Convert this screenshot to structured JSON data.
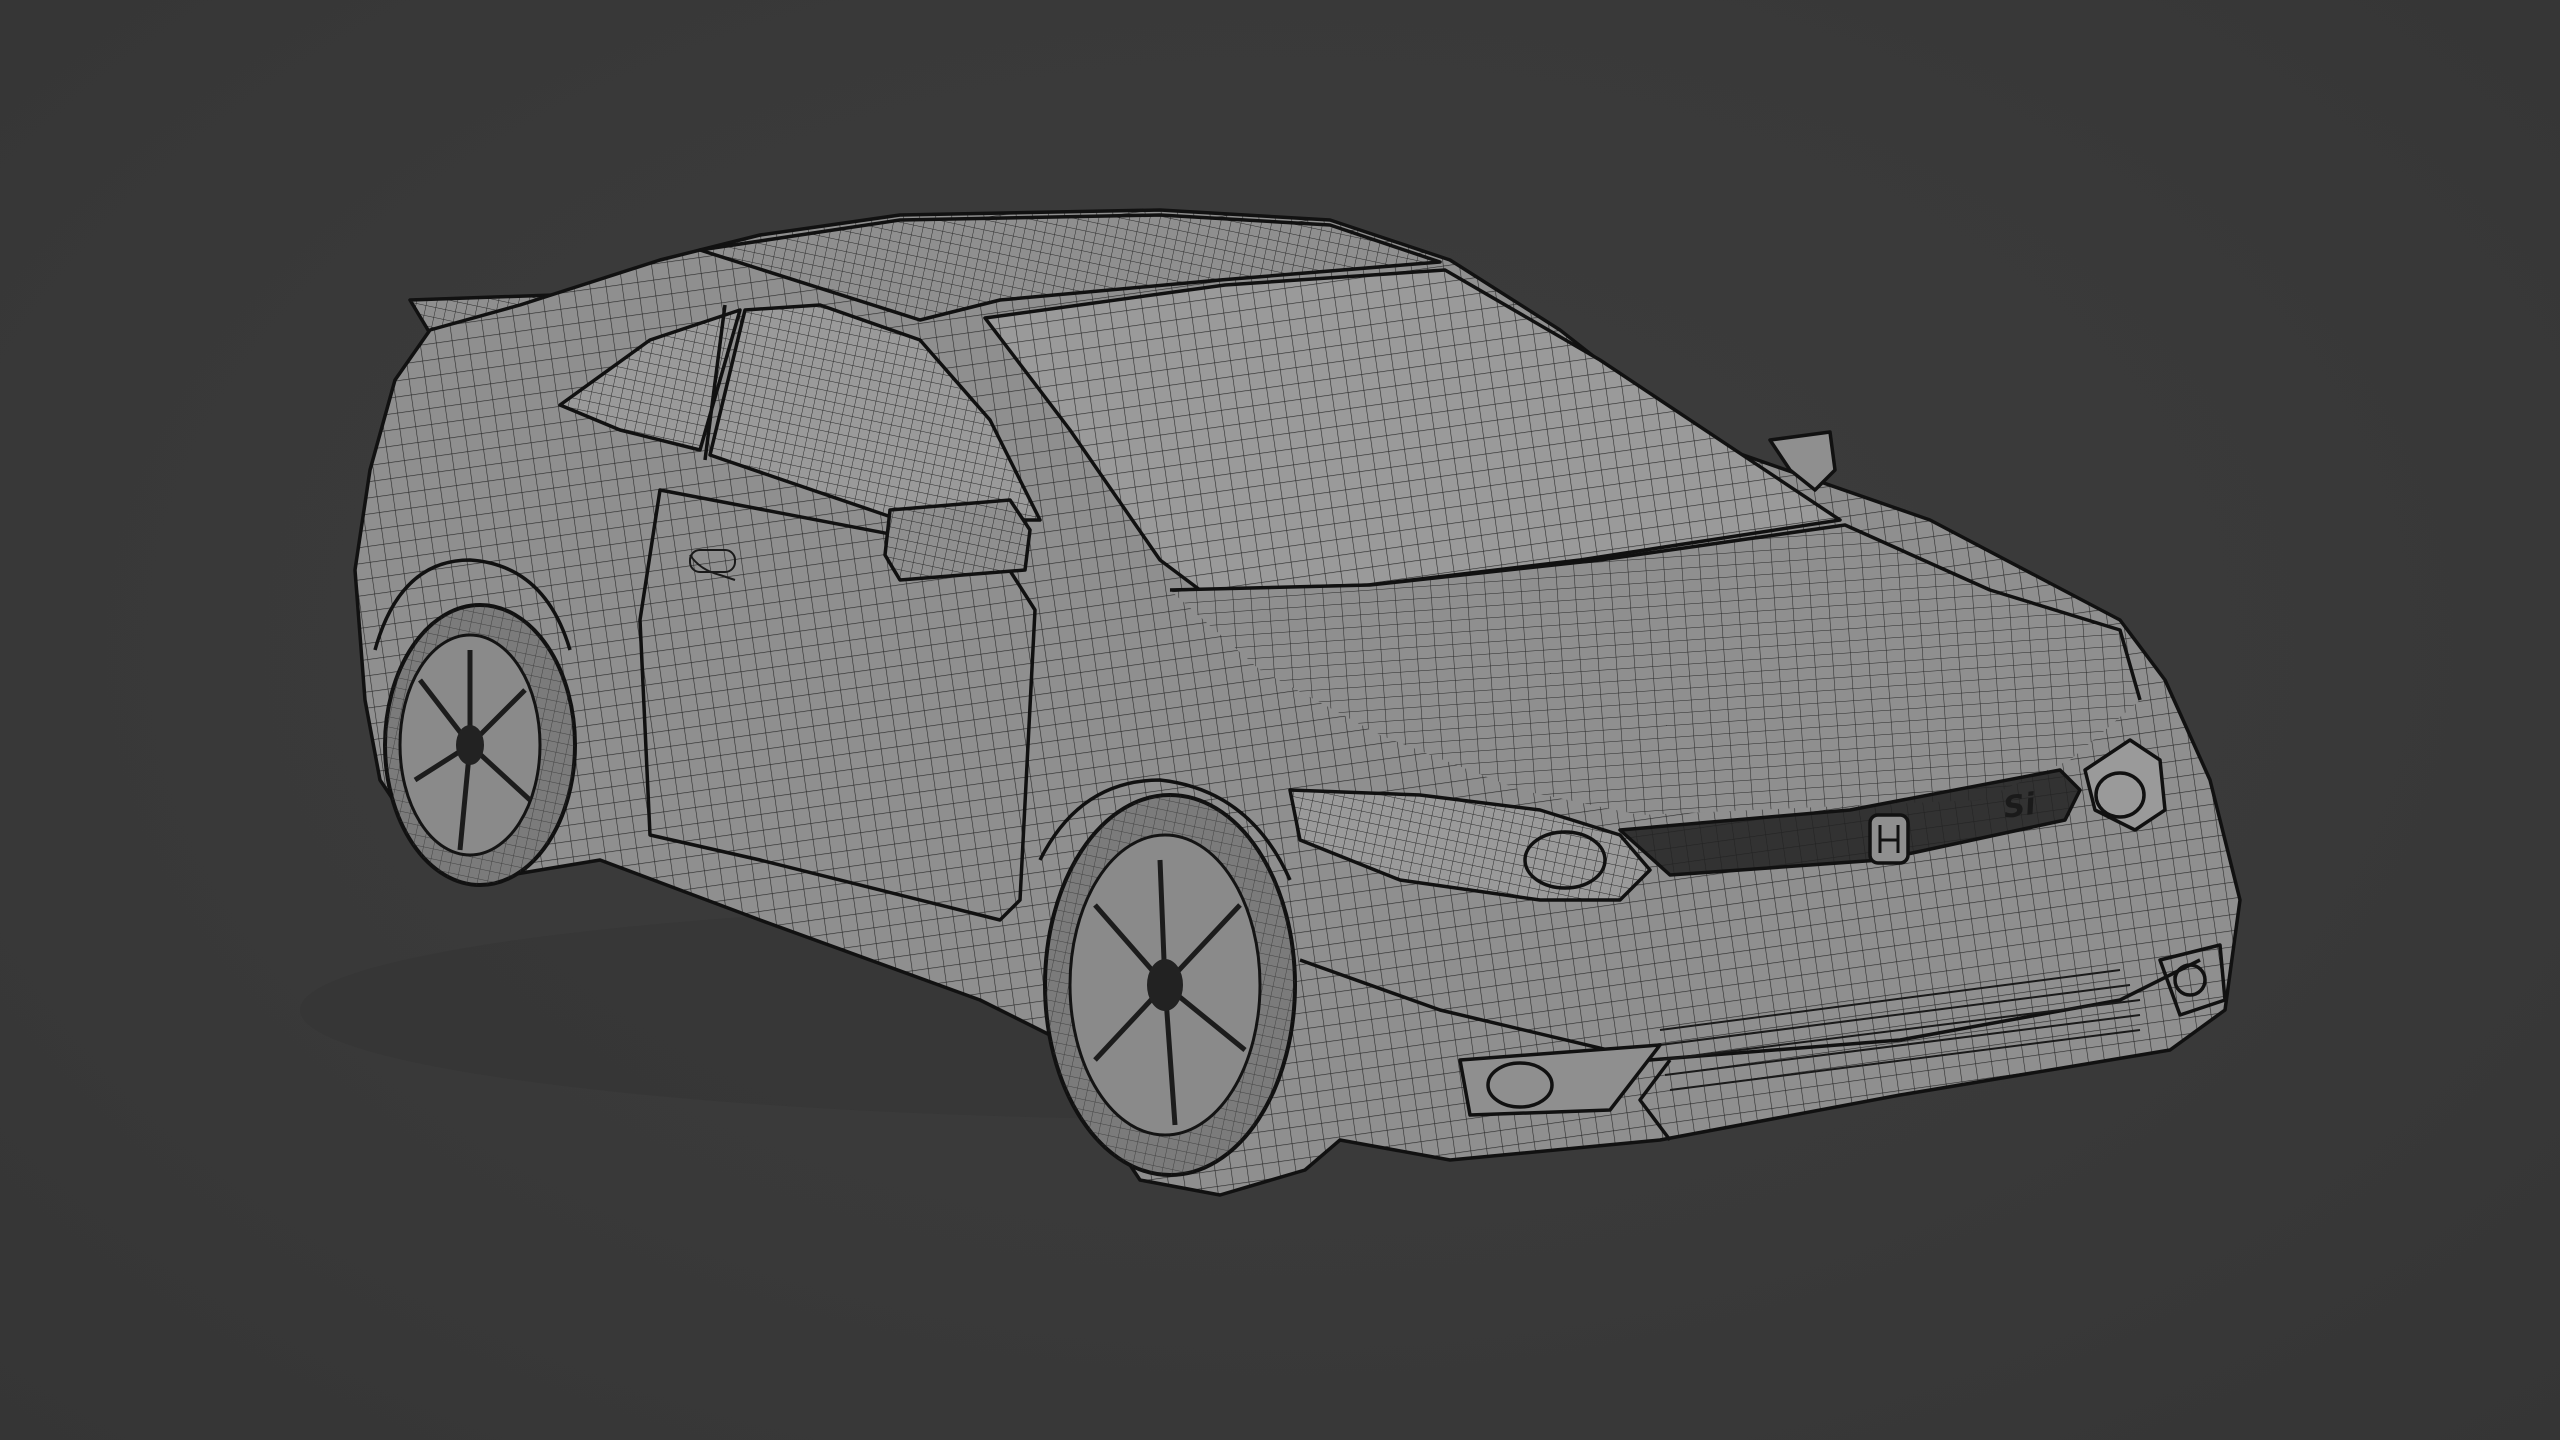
{
  "viewport": {
    "background": "#3a3a3a",
    "mode": "wireframe",
    "object_color": "#8f8f8f",
    "wire_color": "#1a1a1a"
  },
  "model": {
    "grille_badge": "Si"
  }
}
